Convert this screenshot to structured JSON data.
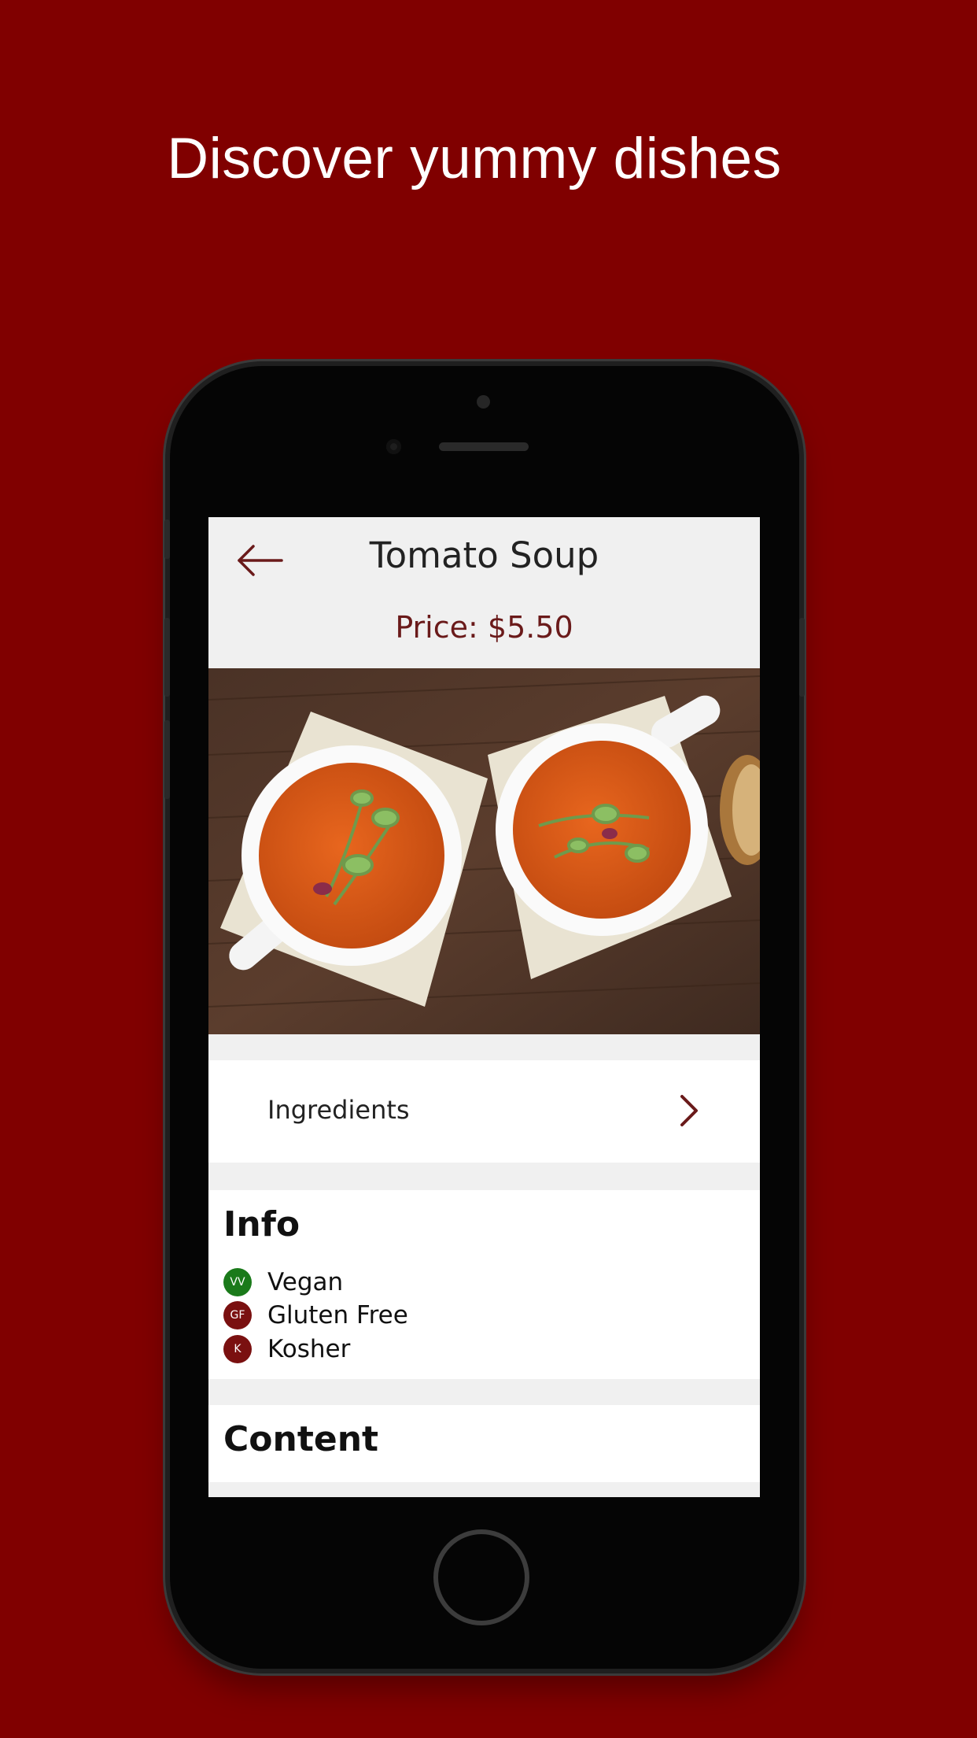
{
  "headline": "Discover yummy dishes",
  "screen": {
    "title": "Tomato Soup",
    "price": "Price: $5.50",
    "ingredients_label": "Ingredients",
    "info": {
      "heading": "Info",
      "tags": [
        {
          "badge": "VV",
          "label": "Vegan",
          "color": "#1a7a1a"
        },
        {
          "badge": "GF",
          "label": "Gluten Free",
          "color": "#7a1010"
        },
        {
          "badge": "K",
          "label": "Kosher",
          "color": "#7a1010"
        }
      ]
    },
    "content_heading": "Content"
  },
  "colors": {
    "background": "#800000",
    "accent": "#6a1a1a"
  },
  "icons": [
    "back-arrow-icon",
    "chevron-right-icon"
  ]
}
